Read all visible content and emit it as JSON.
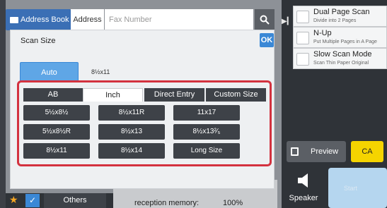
{
  "address_bar": {
    "address_book_label": "Address Book",
    "address_tab_label": "Address",
    "fax_placeholder": "Fax Number"
  },
  "scan_size": {
    "title": "Scan Size",
    "ok_label": "OK",
    "auto_label": "Auto",
    "auto_value": "8½x11",
    "tabs": [
      "AB",
      "Inch",
      "Direct Entry",
      "Custom Size"
    ],
    "active_tab": "Inch",
    "sizes": [
      [
        "5½x8½",
        "8½x11R",
        "11x17"
      ],
      [
        "5½x8½R",
        "8½x13",
        "8½x13²⁄₅"
      ],
      [
        "8½x11",
        "8½x14",
        "Long Size"
      ]
    ]
  },
  "right_options": [
    {
      "title": "Dual Page Scan",
      "subtitle": "Divide into 2 Pages"
    },
    {
      "title": "N-Up",
      "subtitle": "Put Multiple Pages in A Page"
    },
    {
      "title": "Slow Scan Mode",
      "subtitle": "Scan Thin Paper Original"
    }
  ],
  "actions": {
    "preview_label": "Preview",
    "ca_label": "CA",
    "speaker_label": "Speaker",
    "start_label": "Start"
  },
  "footer": {
    "others_label": "Others",
    "memory_label": "reception memory",
    "memory_value": "100%"
  },
  "colors": {
    "accent_blue": "#3b88d6",
    "highlight_red": "#d3323f",
    "ca_yellow": "#f5d400"
  }
}
